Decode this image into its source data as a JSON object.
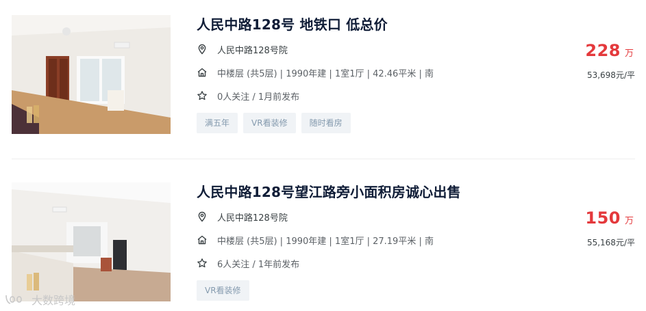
{
  "listings": [
    {
      "title": "人民中路128号 地铁口 低总价",
      "address": "人民中路128号院",
      "info": "中楼层 (共5层) | 1990年建 | 1室1厅 | 42.46平米 | 南",
      "follow": "0人关注 / 1月前发布",
      "tags": [
        "满五年",
        "VR看装修",
        "随时看房"
      ],
      "price": "228",
      "price_unit": "万",
      "unit_price": "53,698元/平"
    },
    {
      "title": "人民中路128号望江路旁小面积房诚心出售",
      "address": "人民中路128号院",
      "info": "中楼层 (共5层) | 1990年建 | 1室1厅 | 27.19平米 | 南",
      "follow": "6人关注 / 1年前发布",
      "tags": [
        "VR看装修"
      ],
      "price": "150",
      "price_unit": "万",
      "unit_price": "55,168元/平"
    }
  ],
  "watermark": "大数跨境",
  "icons": {
    "address": "location-pin-icon",
    "info": "house-icon",
    "follow": "star-icon"
  },
  "colors": {
    "price": "#e4393c",
    "title": "#101d37",
    "tag_bg": "#f0f3f6",
    "tag_text": "#849aae"
  }
}
